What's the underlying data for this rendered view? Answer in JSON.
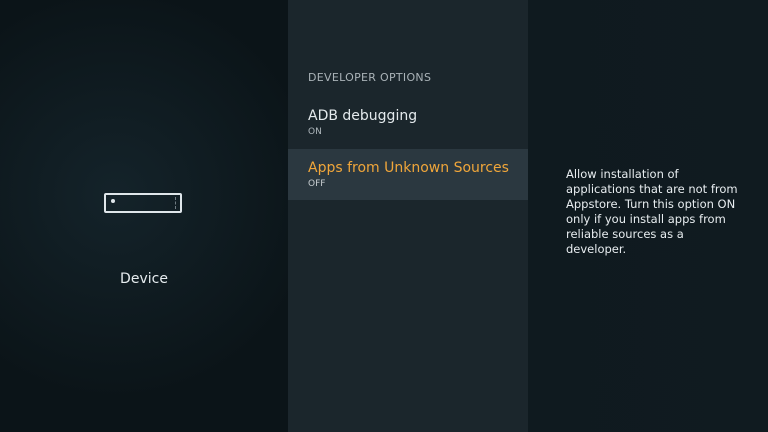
{
  "left_pane": {
    "icon": "device-icon",
    "label": "Device"
  },
  "middle_pane": {
    "section_header": "DEVELOPER OPTIONS",
    "items": [
      {
        "title": "ADB debugging",
        "value": "ON"
      },
      {
        "title": "Apps from Unknown Sources",
        "value": "OFF"
      }
    ],
    "selected_color": "#f0a63a"
  },
  "right_pane": {
    "description": "Allow installation of applications that are not from Appstore. Turn this option ON only if you install apps from reliable sources as a developer."
  }
}
